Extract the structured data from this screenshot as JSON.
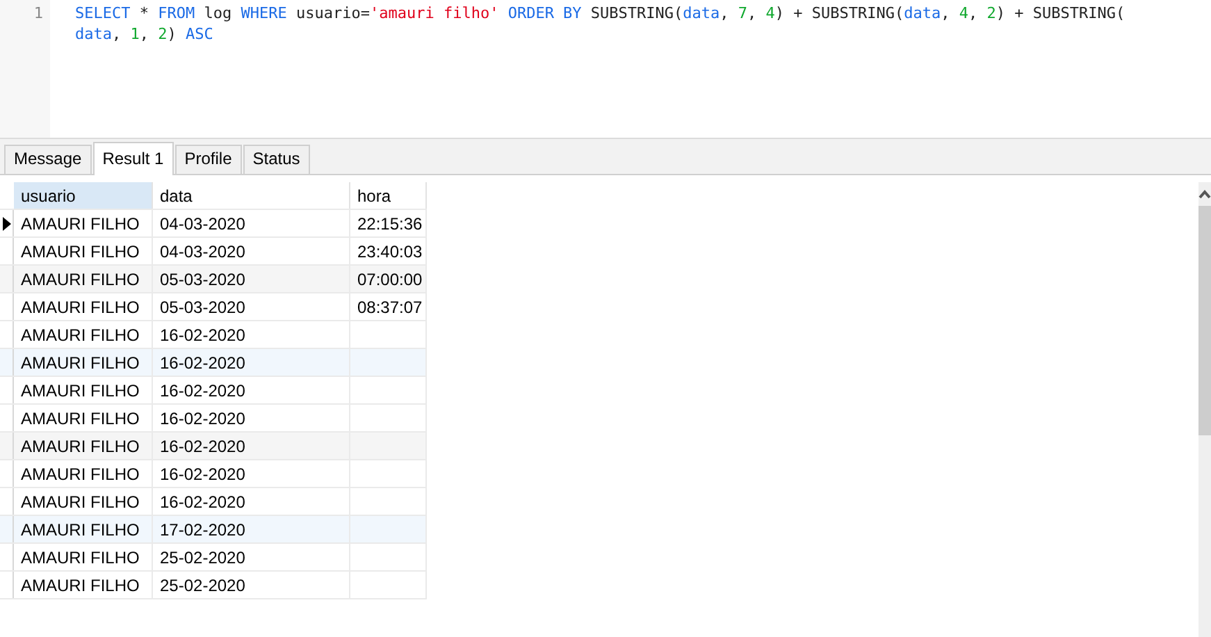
{
  "editor": {
    "line_numbers": [
      "1"
    ],
    "lines": [
      [
        {
          "text": "SELECT",
          "kind": "keyword"
        },
        {
          "text": " * ",
          "kind": "plain"
        },
        {
          "text": "FROM",
          "kind": "keyword"
        },
        {
          "text": " log ",
          "kind": "plain"
        },
        {
          "text": "WHERE",
          "kind": "keyword"
        },
        {
          "text": " usuario=",
          "kind": "plain"
        },
        {
          "text": "'amauri filho'",
          "kind": "string"
        },
        {
          "text": " ORDER BY",
          "kind": "keyword"
        },
        {
          "text": " SUBSTRING(",
          "kind": "plain"
        },
        {
          "text": "data",
          "kind": "keyword"
        },
        {
          "text": ", ",
          "kind": "plain"
        },
        {
          "text": "7",
          "kind": "number"
        },
        {
          "text": ", ",
          "kind": "plain"
        },
        {
          "text": "4",
          "kind": "number"
        },
        {
          "text": ") + SUBSTRING(",
          "kind": "plain"
        },
        {
          "text": "data",
          "kind": "keyword"
        },
        {
          "text": ", ",
          "kind": "plain"
        },
        {
          "text": "4",
          "kind": "number"
        },
        {
          "text": ", ",
          "kind": "plain"
        },
        {
          "text": "2",
          "kind": "number"
        },
        {
          "text": ") + SUBSTRING(",
          "kind": "plain"
        }
      ],
      [
        {
          "text": "data",
          "kind": "keyword"
        },
        {
          "text": ", ",
          "kind": "plain"
        },
        {
          "text": "1",
          "kind": "number"
        },
        {
          "text": ", ",
          "kind": "plain"
        },
        {
          "text": "2",
          "kind": "number"
        },
        {
          "text": ") ",
          "kind": "plain"
        },
        {
          "text": "ASC",
          "kind": "keyword"
        }
      ]
    ]
  },
  "tabs": [
    {
      "label": "Message",
      "selected": false
    },
    {
      "label": "Result 1",
      "selected": true
    },
    {
      "label": "Profile",
      "selected": false
    },
    {
      "label": "Status",
      "selected": false
    }
  ],
  "table": {
    "columns": [
      {
        "label": "usuario",
        "selected": true
      },
      {
        "label": "data",
        "selected": false
      },
      {
        "label": "hora",
        "selected": false
      }
    ],
    "rows": [
      {
        "cells": [
          "AMAURI FILHO",
          "04-03-2020",
          "22:15:36"
        ],
        "selected": true,
        "kind": "plain"
      },
      {
        "cells": [
          "AMAURI FILHO",
          "04-03-2020",
          "23:40:03"
        ],
        "selected": false,
        "kind": "plain"
      },
      {
        "cells": [
          "AMAURI FILHO",
          "05-03-2020",
          "07:00:00"
        ],
        "selected": false,
        "kind": "grey"
      },
      {
        "cells": [
          "AMAURI FILHO",
          "05-03-2020",
          "08:37:07"
        ],
        "selected": false,
        "kind": "plain"
      },
      {
        "cells": [
          "AMAURI FILHO",
          "16-02-2020"
        ],
        "selected": false,
        "kind": "plain"
      },
      {
        "cells": [
          "AMAURI FILHO",
          "16-02-2020"
        ],
        "selected": false,
        "kind": "blue"
      },
      {
        "cells": [
          "AMAURI FILHO",
          "16-02-2020"
        ],
        "selected": false,
        "kind": "plain"
      },
      {
        "cells": [
          "AMAURI FILHO",
          "16-02-2020"
        ],
        "selected": false,
        "kind": "plain"
      },
      {
        "cells": [
          "AMAURI FILHO",
          "16-02-2020"
        ],
        "selected": false,
        "kind": "grey"
      },
      {
        "cells": [
          "AMAURI FILHO",
          "16-02-2020"
        ],
        "selected": false,
        "kind": "plain"
      },
      {
        "cells": [
          "AMAURI FILHO",
          "16-02-2020"
        ],
        "selected": false,
        "kind": "plain"
      },
      {
        "cells": [
          "AMAURI FILHO",
          "17-02-2020"
        ],
        "selected": false,
        "kind": "blue"
      },
      {
        "cells": [
          "AMAURI FILHO",
          "25-02-2020"
        ],
        "selected": false,
        "kind": "plain"
      },
      {
        "cells": [
          "AMAURI FILHO",
          "25-02-2020"
        ],
        "selected": false,
        "kind": "plain"
      }
    ]
  }
}
